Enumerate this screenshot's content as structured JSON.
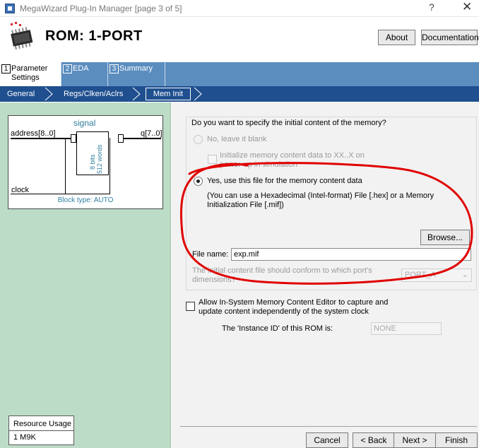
{
  "window": {
    "title": "MegaWizard Plug-In Manager [page 3 of 5]",
    "help_glyph": "?",
    "close_glyph": "✕"
  },
  "header": {
    "title": "ROM: 1-PORT",
    "about_label": "About",
    "documentation_label": "Documentation"
  },
  "steps": [
    {
      "num": "1",
      "label": "Parameter Settings",
      "active": true
    },
    {
      "num": "2",
      "label": "EDA",
      "active": false
    },
    {
      "num": "3",
      "label": "Summary",
      "active": false
    }
  ],
  "subtabs": [
    {
      "label": "General"
    },
    {
      "label": "Regs/Clken/Aclrs"
    },
    {
      "label": "Mem Init",
      "active": true
    }
  ],
  "diagram": {
    "signal": "signal",
    "address": "address[8..0]",
    "q": "q[7..0]",
    "clock": "clock",
    "bits": "8 bits",
    "words": "512 words",
    "block_type": "Block type: AUTO"
  },
  "resource_usage": {
    "title": "Resource Usage",
    "value": "1 M9K"
  },
  "mem_init": {
    "question": "Do you want to specify the initial content of the memory?",
    "option_no": "No, leave it blank",
    "initialize_xx_line1": "Initialize memory content data to XX..X on",
    "initialize_xx_line2": "power-up in simulation",
    "option_yes": "Yes, use this file for the memory content data",
    "hint_line1": "(You can use a Hexadecimal (Intel-format) File [.hex] or a Memory",
    "hint_line2": "Initialization File [.mif])",
    "browse_label": "Browse...",
    "file_name_label": "File name:",
    "file_name_value": "exp.mif",
    "conform_line1": "The initial content file should conform to which port's",
    "conform_line2": "dimensions?",
    "port_value": "PORT_A",
    "allow_line1": "Allow In-System Memory Content Editor to capture and",
    "allow_line2": "update content independently of the system clock",
    "instance_label": "The 'Instance ID' of this ROM is:",
    "instance_value": "NONE"
  },
  "footer": {
    "cancel": "Cancel",
    "back": "< Back",
    "next": "Next >",
    "finish": "Finish"
  },
  "colors": {
    "step_bar": "#5b8dbf",
    "subtab_bar": "#1f4f8f",
    "left_panel": "#bddcc7",
    "annotation": "#e00000"
  }
}
